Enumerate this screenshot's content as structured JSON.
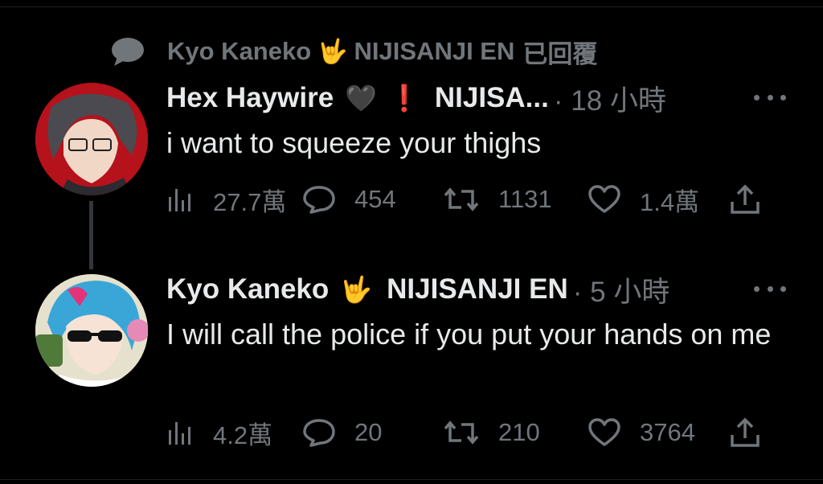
{
  "reply_context": {
    "name": "Kyo Kaneko",
    "emoji": "🤟",
    "org": "NIJISANJI EN",
    "action": "已回覆"
  },
  "tweets": [
    {
      "name": "Hex Haywire",
      "emoji1": "🖤",
      "emoji2": "❗",
      "org": "NIJISA...",
      "time": "· 18 小時",
      "text": "i want to squeeze your thighs",
      "views": "27.7萬",
      "replies": "454",
      "retweets": "1131",
      "likes": "1.4萬"
    },
    {
      "name": "Kyo Kaneko",
      "emoji1": "🤟",
      "org": "NIJISANJI EN",
      "time": "· 5 小時",
      "text": "I will call the police if you put your hands on me",
      "views": "4.2萬",
      "replies": "20",
      "retweets": "210",
      "likes": "3764"
    }
  ],
  "colors": {
    "background": "#000000",
    "text": "#e7e9ea",
    "muted": "#71767b",
    "thread_line": "#333639"
  }
}
